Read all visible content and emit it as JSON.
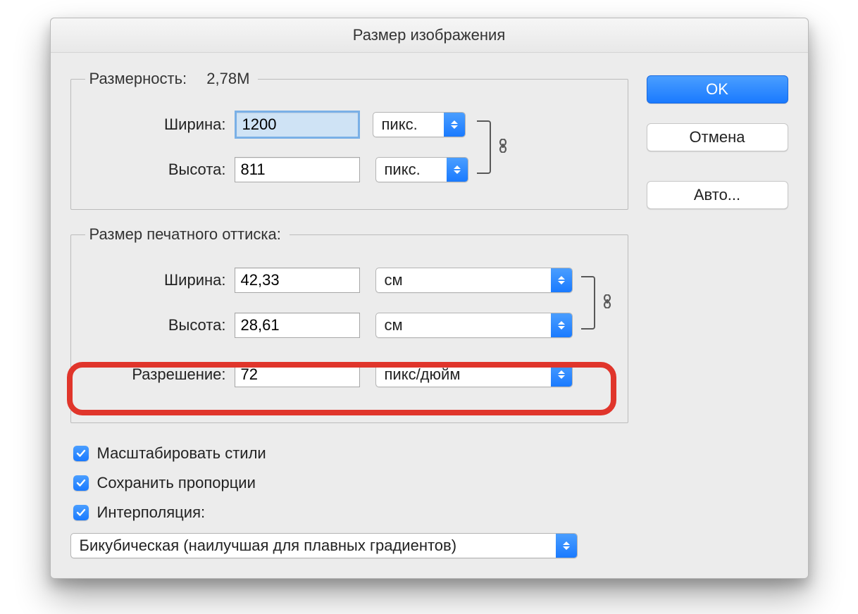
{
  "title": "Размер изображения",
  "pixel_dimensions": {
    "legend": "Размерность:",
    "size": "2,78M",
    "width_label": "Ширина:",
    "width_value": "1200",
    "height_label": "Высота:",
    "height_value": "811",
    "unit": "пикс."
  },
  "document_size": {
    "legend": "Размер печатного оттиска:",
    "width_label": "Ширина:",
    "width_value": "42,33",
    "height_label": "Высота:",
    "height_value": "28,61",
    "unit": "см",
    "resolution_label": "Разрешение:",
    "resolution_value": "72",
    "resolution_unit": "пикс/дюйм"
  },
  "checks": {
    "scale_styles": "Масштабировать стили",
    "constrain": "Сохранить пропорции",
    "resample": "Интерполяция:"
  },
  "interpolation_method": "Бикубическая (наилучшая для плавных градиентов)",
  "buttons": {
    "ok": "OK",
    "cancel": "Отмена",
    "auto": "Авто..."
  }
}
